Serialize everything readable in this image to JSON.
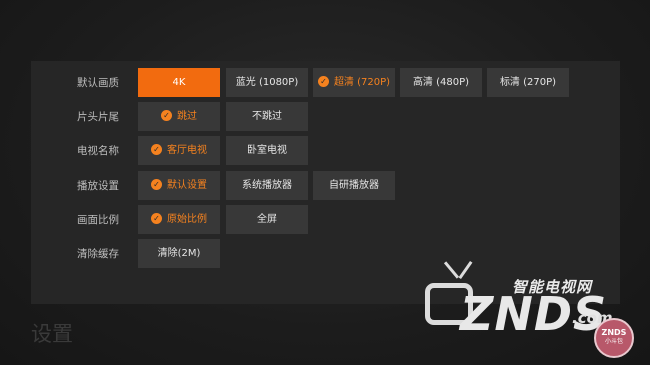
{
  "page_title": "设置",
  "settings": [
    {
      "label": "默认画质",
      "options": [
        {
          "text": "4K",
          "state": "focused"
        },
        {
          "text": "蓝光 (1080P)",
          "state": "normal"
        },
        {
          "text": "超清 (720P)",
          "state": "selected"
        },
        {
          "text": "高清 (480P)",
          "state": "normal"
        },
        {
          "text": "标清 (270P)",
          "state": "normal"
        }
      ]
    },
    {
      "label": "片头片尾",
      "options": [
        {
          "text": "跳过",
          "state": "selected"
        },
        {
          "text": "不跳过",
          "state": "normal"
        }
      ]
    },
    {
      "label": "电视名称",
      "options": [
        {
          "text": "客厅电视",
          "state": "selected"
        },
        {
          "text": "卧室电视",
          "state": "normal"
        }
      ]
    },
    {
      "label": "播放设置",
      "options": [
        {
          "text": "默认设置",
          "state": "selected"
        },
        {
          "text": "系统播放器",
          "state": "normal"
        },
        {
          "text": "自研播放器",
          "state": "normal"
        }
      ]
    },
    {
      "label": "画面比例",
      "options": [
        {
          "text": "原始比例",
          "state": "selected"
        },
        {
          "text": "全屏",
          "state": "normal"
        }
      ]
    },
    {
      "label": "清除缓存",
      "options": [
        {
          "text": "清除(2M)",
          "state": "normal"
        }
      ]
    }
  ],
  "watermark": {
    "tagline": "智能电视网",
    "brand": "ZNDS",
    "domain": ".com",
    "badge_top": "ZNDS",
    "badge_bottom": "小斗包"
  },
  "colors": {
    "accent": "#f26b0f",
    "selected_text": "#f5821f",
    "button_bg": "#383838",
    "panel_bg": "#262626"
  }
}
